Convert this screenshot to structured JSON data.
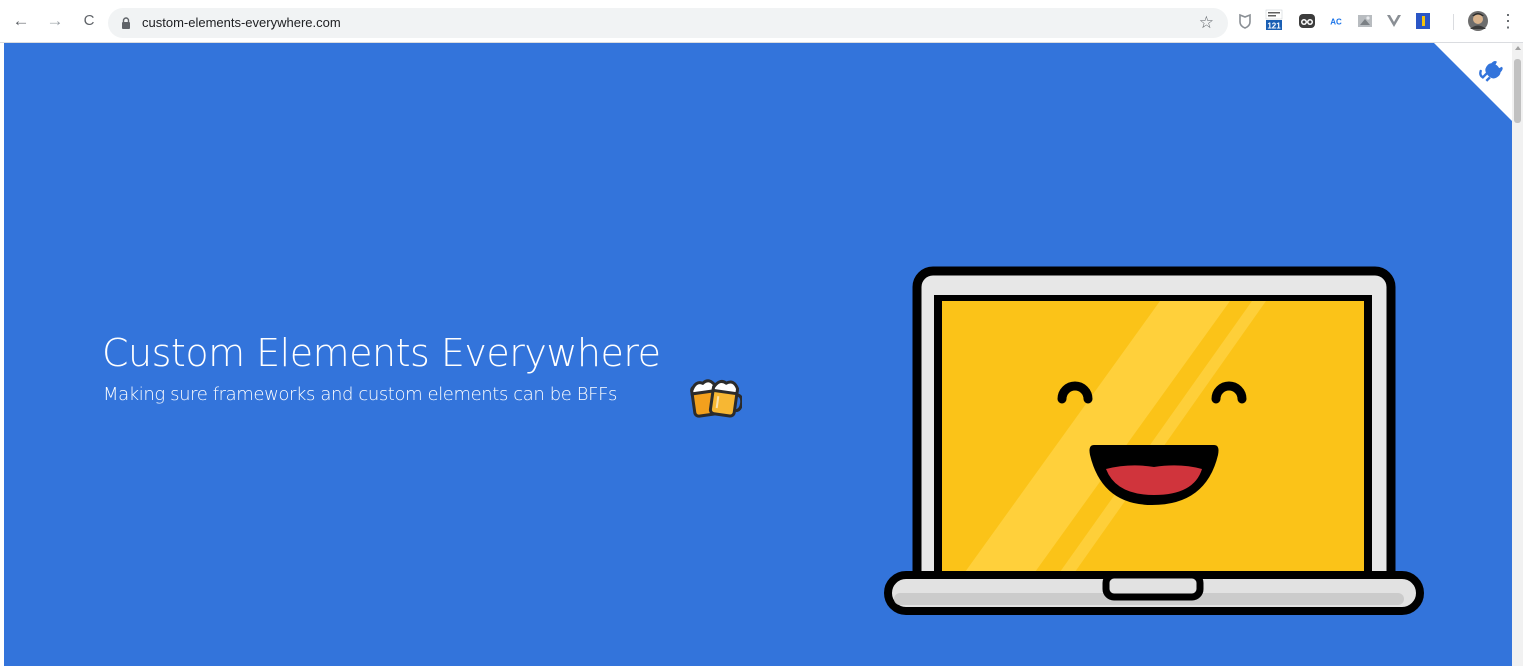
{
  "browser": {
    "url": "custom-elements-everywhere.com",
    "nav": {
      "back_icon": "←",
      "forward_icon": "→",
      "reload_icon": "C"
    },
    "bookmark_icon": "☆",
    "menu_icon": "⋮",
    "extensions": [
      {
        "name": "shield-extension-icon"
      },
      {
        "name": "calendar-extension-icon",
        "badge": "121"
      },
      {
        "name": "glasses-extension-icon"
      },
      {
        "name": "ac-extension-icon",
        "label": "AC"
      },
      {
        "name": "puzzle-extension-icon"
      },
      {
        "name": "vue-devtools-extension-icon"
      },
      {
        "name": "blue-box-extension-icon"
      },
      {
        "name": "profile-avatar-icon"
      }
    ]
  },
  "hero": {
    "title": "Custom Elements Everywhere",
    "subtitle": "Making sure frameworks and custom elements can be BFFs",
    "background_color": "#3374db",
    "emoji_icon": "beer-mugs-icon",
    "illustration_icon": "happy-laptop-icon",
    "corner_link_icon": "github-octocat-icon"
  }
}
